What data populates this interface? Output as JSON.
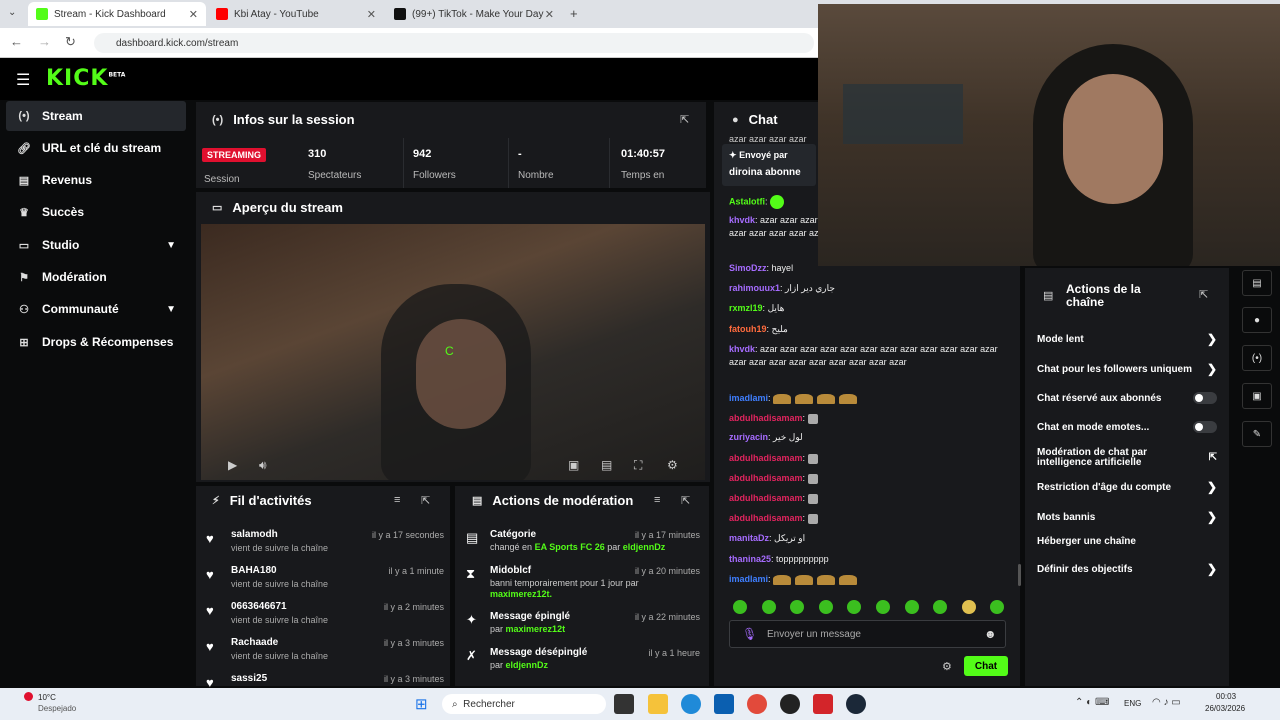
{
  "browser": {
    "tabs": [
      {
        "title": "Stream - Kick Dashboard",
        "color": "#53fc18"
      },
      {
        "title": "Kbi Atay - YouTube",
        "color": "#ff0000"
      },
      {
        "title": "(99+) TikTok - Make Your Day",
        "color": "#111111"
      }
    ],
    "url": "dashboard.kick.com/stream"
  },
  "brand": {
    "logo": "KICK",
    "beta": "BETA",
    "accent": "#53fc18"
  },
  "sidebar": {
    "items": [
      {
        "label": "Stream",
        "icon": "stream-icon"
      },
      {
        "label": "URL et clé du stream",
        "icon": "link-icon"
      },
      {
        "label": "Revenus",
        "icon": "revenue-icon"
      },
      {
        "label": "Succès",
        "icon": "trophy-icon"
      },
      {
        "label": "Studio",
        "icon": "studio-icon"
      },
      {
        "label": "Modération",
        "icon": "moderation-icon"
      },
      {
        "label": "Communauté",
        "icon": "community-icon"
      },
      {
        "label": "Drops & Récompenses",
        "icon": "drops-icon"
      }
    ]
  },
  "session": {
    "title": "Infos sur la session",
    "status": "STREAMING",
    "status_label": "Session",
    "stats": [
      {
        "value": "310",
        "label": "Spectateurs"
      },
      {
        "value": "942",
        "label": "Followers"
      },
      {
        "value": "-",
        "label": "Nombre"
      },
      {
        "value": "01:40:57",
        "label": "Temps en"
      }
    ]
  },
  "preview": {
    "title": "Aperçu du stream"
  },
  "activity": {
    "title": "Fil d'activités",
    "items": [
      {
        "name": "salamodh",
        "sub": "vient de suivre la chaîne",
        "time": "il y a 17 secondes"
      },
      {
        "name": "BAHA180",
        "sub": "vient de suivre la chaîne",
        "time": "il y a 1 minute"
      },
      {
        "name": "0663646671",
        "sub": "vient de suivre la chaîne",
        "time": "il y a 2 minutes"
      },
      {
        "name": "Rachaade",
        "sub": "vient de suivre la chaîne",
        "time": "il y a 3 minutes"
      },
      {
        "name": "sassi25",
        "sub": "",
        "time": "il y a 3 minutes"
      }
    ]
  },
  "modactions": {
    "title": "Actions de modération",
    "items": [
      {
        "name": "Catégorie",
        "line1": "changé en",
        "hl1": "EA Sports FC 26",
        "mid": "par",
        "hl2": "eldjennDz",
        "time": "il y a 17 minutes"
      },
      {
        "name": "Midoblcf",
        "line1": "banni temporairement pour 1 jour par",
        "hl1": "maximerez12t.",
        "mid": "",
        "hl2": "",
        "time": "il y a 20 minutes"
      },
      {
        "name": "Message épinglé",
        "line1": "par",
        "hl1": "maximerez12t",
        "mid": "",
        "hl2": "",
        "time": "il y a 22 minutes"
      },
      {
        "name": "Message désépinglé",
        "line1": "par",
        "hl1": "eldjennDz",
        "mid": "",
        "hl2": "",
        "time": "il y a 1 heure"
      }
    ]
  },
  "chat": {
    "title": "Chat",
    "overflow": "azar azar azar azar",
    "pinned_by": "Envoyé par",
    "pinned_text": "diroina abonne",
    "messages": [
      {
        "user": "Astalotfi",
        "text": "",
        "color": "#53fc18"
      },
      {
        "user": "khvdk",
        "text": "azar azar azar azar azar azar azar azar azar azar azar azar azar azar azar azar azar azar azar azar azar azar",
        "color": "#a66cff"
      },
      {
        "user": "SimoDzz",
        "text": "hayel",
        "color": "#a66cff"
      },
      {
        "user": "rahimouux1",
        "text": "جاري دير ازار",
        "color": "#a66cff"
      },
      {
        "user": "rxmzl19",
        "text": "هايل",
        "color": "#53fc18"
      },
      {
        "user": "fatouh19",
        "text": "مليح",
        "color": "#ff6b3d"
      },
      {
        "user": "khvdk",
        "text": "azar azar azar azar azar azar azar azar azar azar azar azar azar azar azar azar azar azar azar azar azar",
        "color": "#a66cff"
      },
      {
        "user": "imadlami",
        "text": "",
        "color": "#3f7fff"
      },
      {
        "user": "abdulhadisamam",
        "text": "",
        "color": "#e0245e"
      },
      {
        "user": "zuriyacin",
        "text": "لول خير",
        "color": "#a66cff"
      },
      {
        "user": "abdulhadisamam",
        "text": "",
        "color": "#e0245e"
      },
      {
        "user": "abdulhadisamam",
        "text": "",
        "color": "#e0245e"
      },
      {
        "user": "abdulhadisamam",
        "text": "",
        "color": "#e0245e"
      },
      {
        "user": "abdulhadisamam",
        "text": "",
        "color": "#e0245e"
      },
      {
        "user": "manitaDz",
        "text": "او تريكل",
        "color": "#a66cff"
      },
      {
        "user": "thanina25",
        "text": "toppppppppp",
        "color": "#a66cff"
      },
      {
        "user": "imadlami",
        "text": "",
        "color": "#3f7fff"
      }
    ],
    "placeholder": "Envoyer un message",
    "send_label": "Chat"
  },
  "channel_actions": {
    "title": "Actions de la chaîne",
    "items": [
      {
        "label": "Mode lent",
        "kind": "chevron"
      },
      {
        "label": "Chat pour les followers uniquem",
        "kind": "chevron"
      },
      {
        "label": "Chat réservé aux abonnés",
        "kind": "toggle"
      },
      {
        "label": "Chat en mode emotes...",
        "kind": "toggle"
      },
      {
        "label": "Modération de chat par intelligence artificielle",
        "kind": "external"
      },
      {
        "label": "Restriction d'âge du compte",
        "kind": "chevron"
      },
      {
        "label": "Mots bannis",
        "kind": "chevron"
      },
      {
        "label": "Héberger une chaîne",
        "kind": "none"
      },
      {
        "label": "Définir des objectifs",
        "kind": "chevron"
      }
    ]
  },
  "taskbar": {
    "weather_temp": "10°C",
    "weather_desc": "Despejado",
    "search": "Rechercher",
    "lang": "ENG",
    "time": "00:03",
    "date": "26/03/2026"
  }
}
